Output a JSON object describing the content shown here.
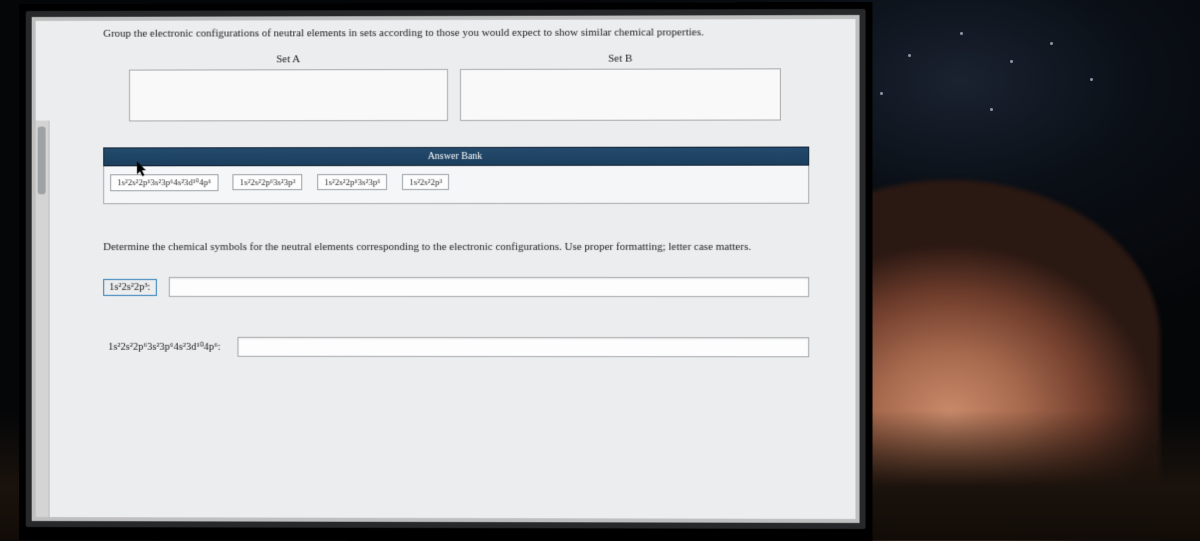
{
  "prompts": {
    "p1": "Group the electronic configurations of neutral elements in sets according to those you would expect to show similar chemical properties.",
    "p2": "Determine the chemical symbols for the neutral elements corresponding to the electronic configurations. Use proper formatting; letter case matters."
  },
  "sets": {
    "labelA": "Set A",
    "labelB": "Set B"
  },
  "answer_bank": {
    "title": "Answer Bank",
    "chips": {
      "c1": "1s²2s²2p⁶3s²3p⁶4s²3d¹⁰4p⁶",
      "c2": "1s²2s²2p⁶3s²3p³",
      "c3": "1s²2s²2p⁶3s²3p⁶",
      "c4": "1s²2s²2p³"
    }
  },
  "answer_rows": {
    "r1_label": "1s²2s²2p³:",
    "r2_label": "1s²2s²2p⁶3s²3p⁶4s²3d¹⁰4p⁶:",
    "r1_value": "",
    "r2_value": ""
  }
}
